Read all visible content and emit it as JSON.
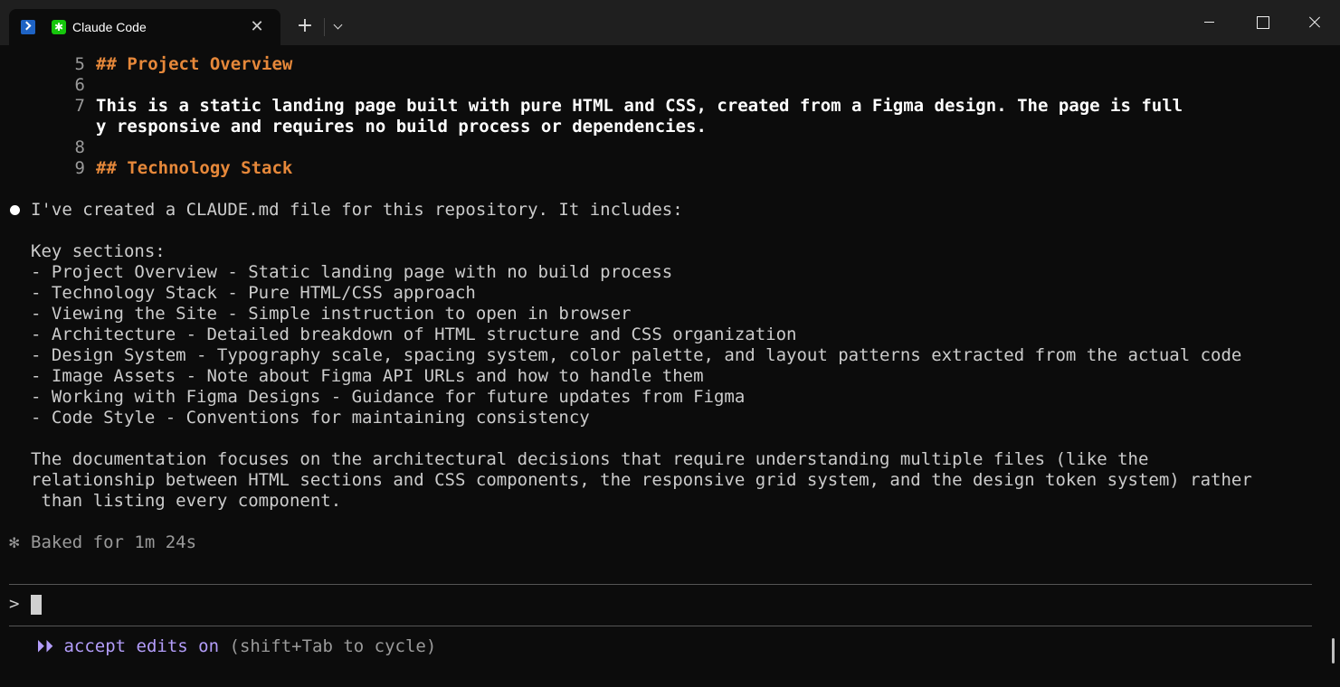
{
  "window": {
    "tab_title": "Claude Code",
    "tab_icons": [
      "powershell-icon",
      "claude-icon"
    ],
    "new_tab_label": "+",
    "close_tab_label": "✕"
  },
  "file_view": [
    {
      "num": "5",
      "text": "## Project Overview",
      "type": "heading"
    },
    {
      "num": "6",
      "text": "",
      "type": "blank"
    },
    {
      "num": "7",
      "text": "This is a static landing page built with pure HTML and CSS, created from a Figma design. The page is full",
      "type": "text"
    },
    {
      "num": "",
      "text": "y responsive and requires no build process or dependencies.",
      "type": "text"
    },
    {
      "num": "8",
      "text": "",
      "type": "blank"
    },
    {
      "num": "9",
      "text": "## Technology Stack",
      "type": "heading"
    }
  ],
  "response": {
    "intro": "I've created a CLAUDE.md file for this repository. It includes:",
    "key_sections_label": "Key sections:",
    "items": [
      "- Project Overview - Static landing page with no build process",
      "- Technology Stack - Pure HTML/CSS approach",
      "- Viewing the Site - Simple instruction to open in browser",
      "- Architecture - Detailed breakdown of HTML structure and CSS organization",
      "- Design System - Typography scale, spacing system, color palette, and layout patterns extracted from the actual code",
      "- Image Assets - Note about Figma API URLs and how to handle them",
      "- Working with Figma Designs - Guidance for future updates from Figma",
      "- Code Style - Conventions for maintaining consistency"
    ],
    "summary_lines": [
      "The documentation focuses on the architectural decisions that require understanding multiple files (like the",
      "relationship between HTML sections and CSS components, the responsive grid system, and the design token system) rather",
      " than listing every component."
    ]
  },
  "status": {
    "spark_glyph": "✻",
    "text": "Baked for 1m 24s"
  },
  "input": {
    "prompt_symbol": ">",
    "value": ""
  },
  "mode": {
    "arrows": "⏵⏵",
    "label": "accept edits on",
    "hint": "(shift+Tab to cycle)"
  },
  "colors": {
    "background": "#0c0c0c",
    "titlebar": "#1f1f1f",
    "heading": "#e6883a",
    "mode_accent": "#b39dfa",
    "muted": "#9a9a9a"
  }
}
